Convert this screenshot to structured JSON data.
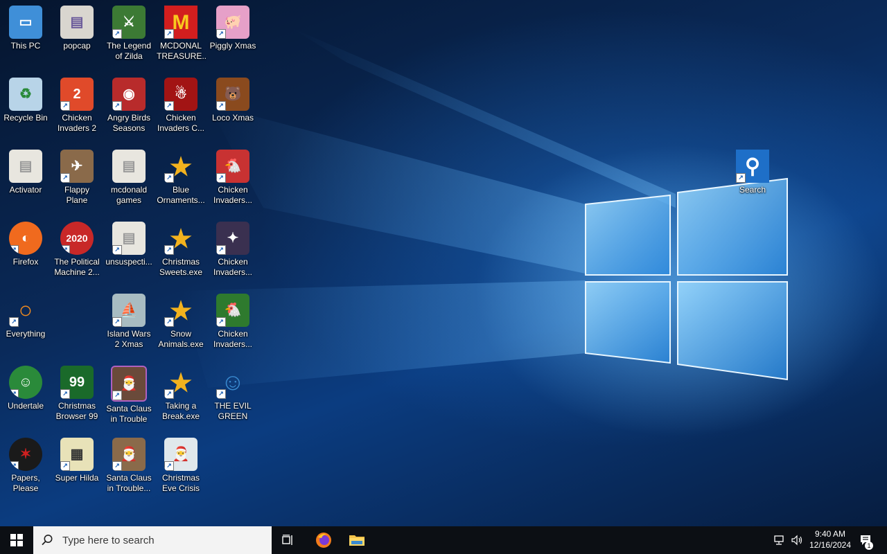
{
  "desktop": {
    "icons": [
      {
        "label": "This PC",
        "glyph": "▭",
        "bg": "#3f8fd8",
        "shortcut": false
      },
      {
        "label": "popcap",
        "glyph": "▤",
        "bg": "#d9d6cf",
        "shortcut": false
      },
      {
        "label": "The Legend of Zilda",
        "glyph": "⚔",
        "bg": "#3c7a34",
        "shortcut": true
      },
      {
        "label": "MCDONAL TREASURE...",
        "glyph": "M",
        "bg": "#d21e1e",
        "shortcut": true
      },
      {
        "label": "Piggly Xmas",
        "glyph": "🐖",
        "bg": "#e6a0c8",
        "shortcut": true
      },
      {
        "label": "Recycle Bin",
        "glyph": "♻",
        "bg": "#b8d4e8",
        "shortcut": false
      },
      {
        "label": "Chicken Invaders 2",
        "glyph": "2",
        "bg": "#e04a2a",
        "shortcut": true
      },
      {
        "label": "Angry Birds Seasons",
        "glyph": "◉",
        "bg": "#b82b2b",
        "shortcut": true
      },
      {
        "label": "Chicken Invaders C...",
        "glyph": "☃",
        "bg": "#a21414",
        "shortcut": true
      },
      {
        "label": "Loco Xmas",
        "glyph": "🐻",
        "bg": "#8a4a1e",
        "shortcut": true
      },
      {
        "label": "Activator",
        "glyph": "▤",
        "bg": "#e8e6df",
        "shortcut": false
      },
      {
        "label": "Flappy Plane",
        "glyph": "✈",
        "bg": "#8a6a4a",
        "shortcut": true
      },
      {
        "label": "mcdonald games",
        "glyph": "▤",
        "bg": "#e8e6df",
        "shortcut": false
      },
      {
        "label": "Blue Ornaments...",
        "glyph": "★",
        "bg": "#f2b21e",
        "shortcut": true
      },
      {
        "label": "Chicken Invaders...",
        "glyph": "🐔",
        "bg": "#c83232",
        "shortcut": true
      },
      {
        "label": "Firefox",
        "glyph": "◐",
        "bg": "#f06a1e",
        "shortcut": true
      },
      {
        "label": "The Political Machine 2...",
        "glyph": "2020",
        "bg": "#c82828",
        "shortcut": true
      },
      {
        "label": "unsuspecti...",
        "glyph": "▤",
        "bg": "#e8e6df",
        "shortcut": true
      },
      {
        "label": "Christmas Sweets.exe",
        "glyph": "★",
        "bg": "#f2b21e",
        "shortcut": true
      },
      {
        "label": "Chicken Invaders...",
        "glyph": "✦",
        "bg": "#3a3050",
        "shortcut": true
      },
      {
        "label": "Everything",
        "glyph": "○",
        "bg": "#f08a1e",
        "shortcut": true
      },
      {
        "label": "Island Wars 2 Xmas",
        "glyph": "⛵",
        "bg": "#a8bcc2",
        "shortcut": true
      },
      {
        "label": "Snow Animals.exe",
        "glyph": "★",
        "bg": "#f2b21e",
        "shortcut": true
      },
      {
        "label": "Chicken Invaders...",
        "glyph": "🐔",
        "bg": "#2e7a2e",
        "shortcut": true
      },
      {
        "label": "Undertale",
        "glyph": "☺",
        "bg": "#2a8a3a",
        "shortcut": true
      },
      {
        "label": "Christmas Browser 99",
        "glyph": "99",
        "bg": "#1a6a2a",
        "shortcut": true
      },
      {
        "label": "Santa Claus in Trouble",
        "glyph": "🎅",
        "bg": "#6a4a3a",
        "shortcut": true
      },
      {
        "label": "Taking a Break.exe",
        "glyph": "★",
        "bg": "#f2b21e",
        "shortcut": true
      },
      {
        "label": "THE EVIL GREEN ME...",
        "glyph": "☺",
        "bg": "#3a8ad0",
        "shortcut": true
      },
      {
        "label": "Papers, Please",
        "glyph": "✶",
        "bg": "#1a1a1a",
        "shortcut": true
      },
      {
        "label": "Super Hilda",
        "glyph": "▦",
        "bg": "#e8e2b8",
        "shortcut": true
      },
      {
        "label": "Santa Claus in Trouble...",
        "glyph": "🎅",
        "bg": "#8a6a4a",
        "shortcut": true
      },
      {
        "label": "Christmas Eve Crisis",
        "glyph": "🎅",
        "bg": "#e0e8ec",
        "shortcut": true
      },
      {
        "label": "Search",
        "glyph": "⚲",
        "bg": "#1e6fc8",
        "shortcut": true
      }
    ]
  },
  "taskbar": {
    "search_placeholder": "Type here to search",
    "time": "9:40 AM",
    "date": "12/16/2024",
    "notification_count": "1"
  }
}
